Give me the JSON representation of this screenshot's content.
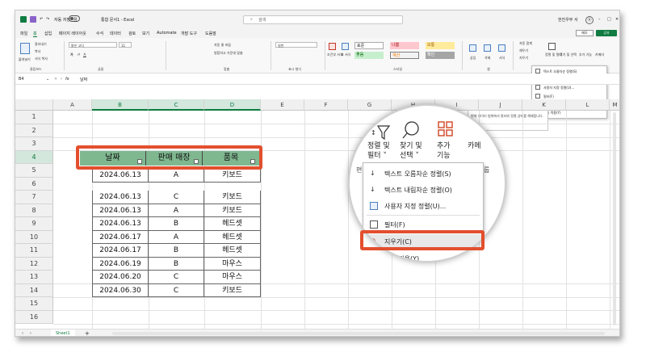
{
  "titlebar": {
    "quick_access": "자동 저장",
    "toggle_state": "끔",
    "doc_title": "통합 문서1 - Excel",
    "search_placeholder": "검색",
    "user_name": "한진우부 서",
    "avatar_initial": "Ⓐ",
    "minimize": "–",
    "restore": "□",
    "close": "✕"
  },
  "menu": {
    "tabs": [
      "파일",
      "홈",
      "삽입",
      "페이지 레이아웃",
      "수식",
      "데이터",
      "검토",
      "보기",
      "Automate",
      "개발 도구",
      "도움말"
    ],
    "active_tab": "홈",
    "memo_button": "메모",
    "share_button": "공유"
  },
  "ribbon": {
    "clipboard": {
      "paste": "붙여넣기",
      "cut": "잘라내기",
      "copy": "복사",
      "format_painter": "서식 복사",
      "group": "클립보드"
    },
    "font": {
      "font_name": "맑은 고딕",
      "font_size": "11",
      "bold": "가",
      "italic": "가",
      "underline": "가",
      "group": "글꼴"
    },
    "alignment": {
      "wrap": "자동 줄 바꿈",
      "merge": "병합하고 가운데 맞춤",
      "group": "맞춤"
    },
    "number": {
      "format": "일반",
      "group": "표시 형식"
    },
    "styles": {
      "conditional": "조건부 서식",
      "table": "표 서식",
      "normal": "표준",
      "bad": "나쁨",
      "good": "보통",
      "neutral": "좋음",
      "calc": "계산",
      "check": "확인",
      "group": "스타일"
    },
    "cells": {
      "insert": "삽입",
      "delete": "삭제",
      "format": "서식",
      "group": "셀"
    },
    "editing": {
      "autosum": "자동 합계",
      "fill": "채우기",
      "clear": "지우기",
      "sort_filter": "정렬 및 필터",
      "find": "찾기 및 선택",
      "addins": "추가 기능",
      "camera": "카메라",
      "group": "편집"
    }
  },
  "mini_menu": {
    "items": [
      "텍스트 오름차순 정렬(S)",
      "텍스트 내림차순 정렬(O)",
      "사용자 지정 정렬(U)...",
      "필터(F)",
      "지우기(C)",
      "다시 적용(Y)"
    ]
  },
  "tooltip": {
    "title": "지우기",
    "body": "현재 데이터 범위에서 필터와 정렬 상태를 해제합니다."
  },
  "formula_bar": {
    "name_box": "B4",
    "fx": "fx",
    "value": "날짜"
  },
  "grid": {
    "columns": [
      "A",
      "B",
      "C",
      "D",
      "E",
      "F",
      "G",
      "H",
      "I",
      "J",
      "K",
      "L",
      "M"
    ],
    "rows": [
      "1",
      "2",
      "3",
      "4",
      "5",
      "6",
      "7",
      "8",
      "9",
      "10",
      "11",
      "12",
      "13",
      "14",
      "15",
      "16"
    ],
    "headers": [
      "날짜",
      "판매 매장",
      "품목"
    ],
    "data": [
      [
        "2024.06.13",
        "A",
        "키보드"
      ],
      [
        "2024.06.13",
        "C",
        "키보드"
      ],
      [
        "2024.06.13",
        "A",
        "키보드"
      ],
      [
        "2024.06.13",
        "B",
        "헤드셋"
      ],
      [
        "2024.06.17",
        "A",
        "헤드셋"
      ],
      [
        "2024.06.17",
        "B",
        "헤드셋"
      ],
      [
        "2024.06.19",
        "B",
        "마우스"
      ],
      [
        "2024.06.20",
        "C",
        "마우스"
      ],
      [
        "2024.06.30",
        "C",
        "키보드"
      ]
    ]
  },
  "magnifier": {
    "sort_filter_label1": "정렬 및",
    "sort_filter_label2": "필터 ˅",
    "find_label1": "찾기 및",
    "find_label2": "선택 ˅",
    "addins_label1": "추가",
    "addins_label2": "기능",
    "camera_label": "카메",
    "editing_group": "편집",
    "menu_items": [
      "텍스트 오름차순 정렬(S)",
      "텍스트 내림차순 정렬(O)",
      "사용자 지정 정렬(U)...",
      "필터(F)",
      "지우기(C)",
      "다시 적용(Y)"
    ],
    "highlighted": "지우기(C)",
    "side_fragment": "룹",
    "left_fragment": "럼"
  },
  "status": {
    "sheet_name": "Sheet1",
    "add_sheet": "+"
  },
  "colors": {
    "excel_green": "#107c41",
    "header_fill": "#7fb78f",
    "highlight_red": "#e34f2e"
  }
}
